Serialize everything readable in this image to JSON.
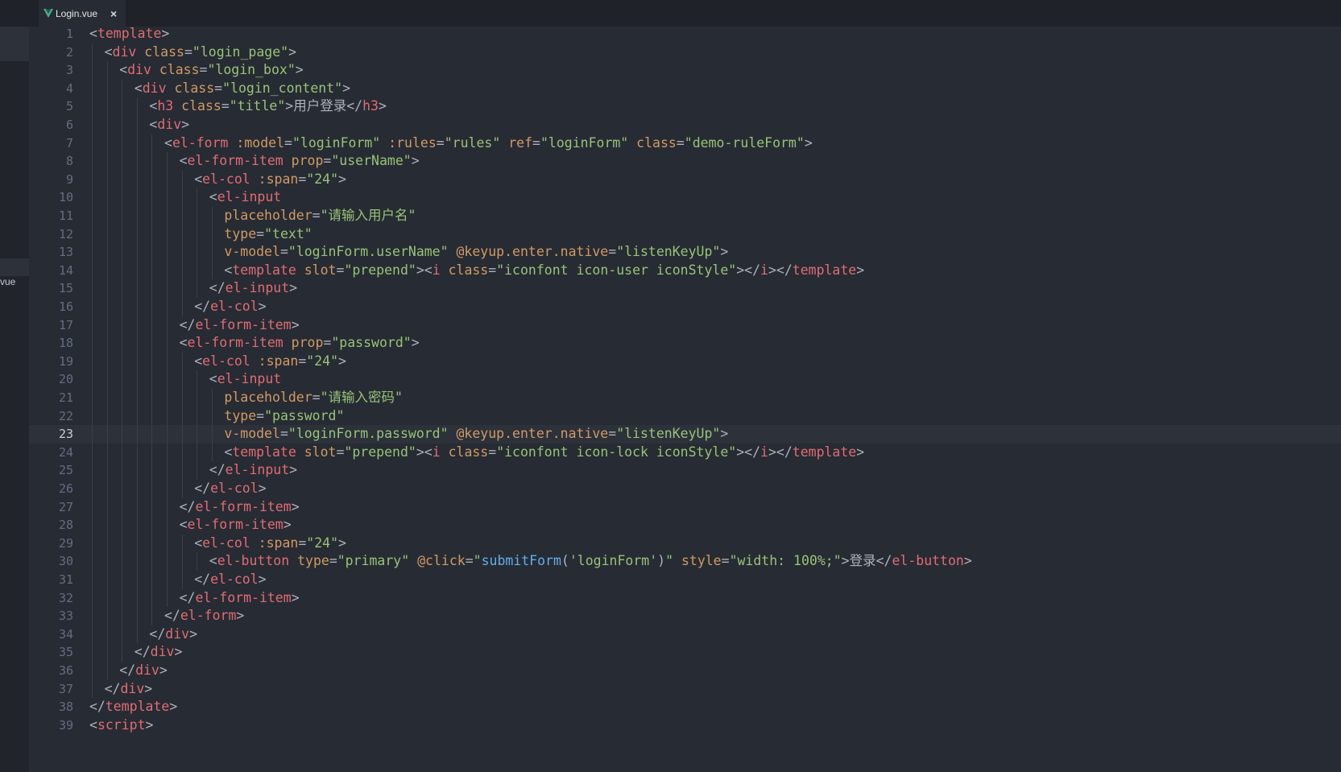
{
  "tab": {
    "title": "Login.vue",
    "close_glyph": "×",
    "icon": "vue-logo-icon"
  },
  "sidebar": {
    "partial_label": "vue"
  },
  "editor": {
    "active_line": 23,
    "lines": [
      {
        "n": "1",
        "indent": 0,
        "tokens": [
          [
            "p",
            "<"
          ],
          [
            "t",
            "template"
          ],
          [
            "p",
            ">"
          ]
        ]
      },
      {
        "n": "2",
        "indent": 1,
        "tokens": [
          [
            "p",
            "<"
          ],
          [
            "t",
            "div"
          ],
          [
            "a",
            " class"
          ],
          [
            "p",
            "="
          ],
          [
            "s",
            "\"login_page\""
          ],
          [
            "p",
            ">"
          ]
        ]
      },
      {
        "n": "3",
        "indent": 2,
        "tokens": [
          [
            "p",
            "<"
          ],
          [
            "t",
            "div"
          ],
          [
            "a",
            " class"
          ],
          [
            "p",
            "="
          ],
          [
            "s",
            "\"login_box\""
          ],
          [
            "p",
            ">"
          ]
        ]
      },
      {
        "n": "4",
        "indent": 3,
        "tokens": [
          [
            "p",
            "<"
          ],
          [
            "t",
            "div"
          ],
          [
            "a",
            " class"
          ],
          [
            "p",
            "="
          ],
          [
            "s",
            "\"login_content\""
          ],
          [
            "p",
            ">"
          ]
        ]
      },
      {
        "n": "5",
        "indent": 4,
        "tokens": [
          [
            "p",
            "<"
          ],
          [
            "t",
            "h3"
          ],
          [
            "a",
            " class"
          ],
          [
            "p",
            "="
          ],
          [
            "s",
            "\"title\""
          ],
          [
            "p",
            ">"
          ],
          [
            "x",
            "用户登录"
          ],
          [
            "p",
            "</"
          ],
          [
            "t",
            "h3"
          ],
          [
            "p",
            ">"
          ]
        ]
      },
      {
        "n": "6",
        "indent": 4,
        "tokens": [
          [
            "p",
            "<"
          ],
          [
            "t",
            "div"
          ],
          [
            "p",
            ">"
          ]
        ]
      },
      {
        "n": "7",
        "indent": 5,
        "tokens": [
          [
            "p",
            "<"
          ],
          [
            "t",
            "el-form"
          ],
          [
            "a",
            " :model"
          ],
          [
            "p",
            "="
          ],
          [
            "s",
            "\"loginForm\""
          ],
          [
            "a",
            " :rules"
          ],
          [
            "p",
            "="
          ],
          [
            "s",
            "\"rules\""
          ],
          [
            "a",
            " ref"
          ],
          [
            "p",
            "="
          ],
          [
            "s",
            "\"loginForm\""
          ],
          [
            "a",
            " class"
          ],
          [
            "p",
            "="
          ],
          [
            "s",
            "\"demo-ruleForm\""
          ],
          [
            "p",
            ">"
          ]
        ]
      },
      {
        "n": "8",
        "indent": 6,
        "tokens": [
          [
            "p",
            "<"
          ],
          [
            "t",
            "el-form-item"
          ],
          [
            "a",
            " prop"
          ],
          [
            "p",
            "="
          ],
          [
            "s",
            "\"userName\""
          ],
          [
            "p",
            ">"
          ]
        ]
      },
      {
        "n": "9",
        "indent": 7,
        "tokens": [
          [
            "p",
            "<"
          ],
          [
            "t",
            "el-col"
          ],
          [
            "a",
            " :span"
          ],
          [
            "p",
            "="
          ],
          [
            "s",
            "\"24\""
          ],
          [
            "p",
            ">"
          ]
        ]
      },
      {
        "n": "10",
        "indent": 8,
        "tokens": [
          [
            "p",
            "<"
          ],
          [
            "t",
            "el-input"
          ]
        ]
      },
      {
        "n": "11",
        "indent": 9,
        "tokens": [
          [
            "a",
            "placeholder"
          ],
          [
            "p",
            "="
          ],
          [
            "s",
            "\"请输入用户名\""
          ]
        ]
      },
      {
        "n": "12",
        "indent": 9,
        "tokens": [
          [
            "a",
            "type"
          ],
          [
            "p",
            "="
          ],
          [
            "s",
            "\"text\""
          ]
        ]
      },
      {
        "n": "13",
        "indent": 9,
        "tokens": [
          [
            "a",
            "v-model"
          ],
          [
            "p",
            "="
          ],
          [
            "s",
            "\"loginForm.userName\""
          ],
          [
            "a",
            " @keyup.enter.native"
          ],
          [
            "p",
            "="
          ],
          [
            "s",
            "\"listenKeyUp\""
          ],
          [
            "p",
            ">"
          ]
        ]
      },
      {
        "n": "14",
        "indent": 9,
        "tokens": [
          [
            "p",
            "<"
          ],
          [
            "t",
            "template"
          ],
          [
            "a",
            " slot"
          ],
          [
            "p",
            "="
          ],
          [
            "s",
            "\"prepend\""
          ],
          [
            "p",
            "><"
          ],
          [
            "t",
            "i"
          ],
          [
            "a",
            " class"
          ],
          [
            "p",
            "="
          ],
          [
            "s",
            "\"iconfont icon-user iconStyle\""
          ],
          [
            "p",
            "></"
          ],
          [
            "t",
            "i"
          ],
          [
            "p",
            "></"
          ],
          [
            "t",
            "template"
          ],
          [
            "p",
            ">"
          ]
        ]
      },
      {
        "n": "15",
        "indent": 8,
        "tokens": [
          [
            "p",
            "</"
          ],
          [
            "t",
            "el-input"
          ],
          [
            "p",
            ">"
          ]
        ]
      },
      {
        "n": "16",
        "indent": 7,
        "tokens": [
          [
            "p",
            "</"
          ],
          [
            "t",
            "el-col"
          ],
          [
            "p",
            ">"
          ]
        ]
      },
      {
        "n": "17",
        "indent": 6,
        "tokens": [
          [
            "p",
            "</"
          ],
          [
            "t",
            "el-form-item"
          ],
          [
            "p",
            ">"
          ]
        ]
      },
      {
        "n": "18",
        "indent": 6,
        "tokens": [
          [
            "p",
            "<"
          ],
          [
            "t",
            "el-form-item"
          ],
          [
            "a",
            " prop"
          ],
          [
            "p",
            "="
          ],
          [
            "s",
            "\"password\""
          ],
          [
            "p",
            ">"
          ]
        ]
      },
      {
        "n": "19",
        "indent": 7,
        "tokens": [
          [
            "p",
            "<"
          ],
          [
            "t",
            "el-col"
          ],
          [
            "a",
            " :span"
          ],
          [
            "p",
            "="
          ],
          [
            "s",
            "\"24\""
          ],
          [
            "p",
            ">"
          ]
        ]
      },
      {
        "n": "20",
        "indent": 8,
        "tokens": [
          [
            "p",
            "<"
          ],
          [
            "t",
            "el-input"
          ]
        ]
      },
      {
        "n": "21",
        "indent": 9,
        "tokens": [
          [
            "a",
            "placeholder"
          ],
          [
            "p",
            "="
          ],
          [
            "s",
            "\"请输入密码\""
          ]
        ]
      },
      {
        "n": "22",
        "indent": 9,
        "tokens": [
          [
            "a",
            "type"
          ],
          [
            "p",
            "="
          ],
          [
            "s",
            "\"password\""
          ]
        ]
      },
      {
        "n": "23",
        "indent": 9,
        "tokens": [
          [
            "a",
            "v-model"
          ],
          [
            "p",
            "="
          ],
          [
            "s",
            "\"loginForm.password\""
          ],
          [
            "a",
            " @keyup.enter.native"
          ],
          [
            "p",
            "="
          ],
          [
            "s",
            "\"listenKeyUp\""
          ],
          [
            "p",
            ">"
          ]
        ]
      },
      {
        "n": "24",
        "indent": 9,
        "tokens": [
          [
            "p",
            "<"
          ],
          [
            "t",
            "template"
          ],
          [
            "a",
            " slot"
          ],
          [
            "p",
            "="
          ],
          [
            "s",
            "\"prepend\""
          ],
          [
            "p",
            "><"
          ],
          [
            "t",
            "i"
          ],
          [
            "a",
            " class"
          ],
          [
            "p",
            "="
          ],
          [
            "s",
            "\"iconfont icon-lock iconStyle\""
          ],
          [
            "p",
            "></"
          ],
          [
            "t",
            "i"
          ],
          [
            "p",
            "></"
          ],
          [
            "t",
            "template"
          ],
          [
            "p",
            ">"
          ]
        ]
      },
      {
        "n": "25",
        "indent": 8,
        "tokens": [
          [
            "p",
            "</"
          ],
          [
            "t",
            "el-input"
          ],
          [
            "p",
            ">"
          ]
        ]
      },
      {
        "n": "26",
        "indent": 7,
        "tokens": [
          [
            "p",
            "</"
          ],
          [
            "t",
            "el-col"
          ],
          [
            "p",
            ">"
          ]
        ]
      },
      {
        "n": "27",
        "indent": 6,
        "tokens": [
          [
            "p",
            "</"
          ],
          [
            "t",
            "el-form-item"
          ],
          [
            "p",
            ">"
          ]
        ]
      },
      {
        "n": "28",
        "indent": 6,
        "tokens": [
          [
            "p",
            "<"
          ],
          [
            "t",
            "el-form-item"
          ],
          [
            "p",
            ">"
          ]
        ]
      },
      {
        "n": "29",
        "indent": 7,
        "tokens": [
          [
            "p",
            "<"
          ],
          [
            "t",
            "el-col"
          ],
          [
            "a",
            " :span"
          ],
          [
            "p",
            "="
          ],
          [
            "s",
            "\"24\""
          ],
          [
            "p",
            ">"
          ]
        ]
      },
      {
        "n": "30",
        "indent": 8,
        "tokens": [
          [
            "p",
            "<"
          ],
          [
            "t",
            "el-button"
          ],
          [
            "a",
            " type"
          ],
          [
            "p",
            "="
          ],
          [
            "s",
            "\"primary\""
          ],
          [
            "a",
            " @click"
          ],
          [
            "p",
            "="
          ],
          [
            "s",
            "\""
          ],
          [
            "f",
            "submitForm"
          ],
          [
            "p",
            "("
          ],
          [
            "s",
            "'loginForm'"
          ],
          [
            "p",
            ")"
          ],
          [
            "s",
            "\""
          ],
          [
            "a",
            " style"
          ],
          [
            "p",
            "="
          ],
          [
            "s",
            "\"width: 100%;\""
          ],
          [
            "p",
            ">"
          ],
          [
            "x",
            "登录"
          ],
          [
            "p",
            "</"
          ],
          [
            "t",
            "el-button"
          ],
          [
            "p",
            ">"
          ]
        ]
      },
      {
        "n": "31",
        "indent": 7,
        "tokens": [
          [
            "p",
            "</"
          ],
          [
            "t",
            "el-col"
          ],
          [
            "p",
            ">"
          ]
        ]
      },
      {
        "n": "32",
        "indent": 6,
        "tokens": [
          [
            "p",
            "</"
          ],
          [
            "t",
            "el-form-item"
          ],
          [
            "p",
            ">"
          ]
        ]
      },
      {
        "n": "33",
        "indent": 5,
        "tokens": [
          [
            "p",
            "</"
          ],
          [
            "t",
            "el-form"
          ],
          [
            "p",
            ">"
          ]
        ]
      },
      {
        "n": "34",
        "indent": 4,
        "tokens": [
          [
            "p",
            "</"
          ],
          [
            "t",
            "div"
          ],
          [
            "p",
            ">"
          ]
        ]
      },
      {
        "n": "35",
        "indent": 3,
        "tokens": [
          [
            "p",
            "</"
          ],
          [
            "t",
            "div"
          ],
          [
            "p",
            ">"
          ]
        ]
      },
      {
        "n": "36",
        "indent": 2,
        "tokens": [
          [
            "p",
            "</"
          ],
          [
            "t",
            "div"
          ],
          [
            "p",
            ">"
          ]
        ]
      },
      {
        "n": "37",
        "indent": 1,
        "tokens": [
          [
            "p",
            "</"
          ],
          [
            "t",
            "div"
          ],
          [
            "p",
            ">"
          ]
        ]
      },
      {
        "n": "38",
        "indent": 0,
        "tokens": [
          [
            "p",
            "</"
          ],
          [
            "t",
            "template"
          ],
          [
            "p",
            ">"
          ]
        ]
      },
      {
        "n": "39",
        "indent": 0,
        "tokens": [
          [
            "p",
            "<"
          ],
          [
            "t",
            "script"
          ],
          [
            "p",
            ">"
          ]
        ]
      }
    ]
  },
  "colors": {
    "background": "#272b33",
    "tag": "#e06c75",
    "attribute": "#d19a66",
    "string": "#98c379",
    "punctuation": "#abb2bf",
    "function": "#61afef",
    "line_number": "#636d83",
    "accent_vue": "#42b883"
  }
}
